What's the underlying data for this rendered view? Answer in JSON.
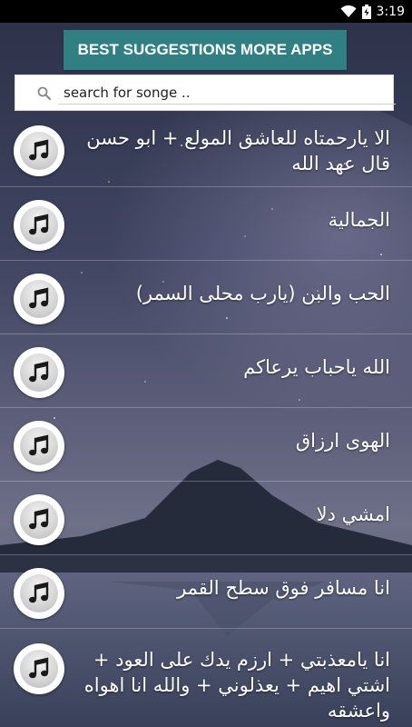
{
  "status_bar": {
    "time": "3:19"
  },
  "header": {
    "suggest_button_label": "BEST SUGGESTIONS MORE APPS"
  },
  "search": {
    "placeholder": "search for songe ..",
    "value": "search for songe .."
  },
  "songs": [
    {
      "title": "الا يارحمتاه للعاشق المولع + ابو حسن قال عهد الله"
    },
    {
      "title": "الجمالية"
    },
    {
      "title": "الحب والبن (يارب محلى السمر)"
    },
    {
      "title": "الله ياحباب يرعاكم"
    },
    {
      "title": "الهوى ارزاق"
    },
    {
      "title": "امشي دلا"
    },
    {
      "title": "انا مسافر فوق سطح القمر"
    },
    {
      "title": "انا يامعذبتي + ارزم يدك على العود + اشتي اهيم + يعذلوني + والله انا اهواه واعشقه"
    }
  ],
  "colors": {
    "accent": "#2f7f83",
    "status_bar": "#000000"
  }
}
